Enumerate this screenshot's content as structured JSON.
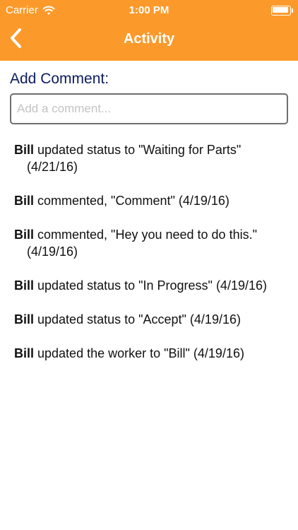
{
  "status_bar": {
    "carrier": "Carrier",
    "time": "1:00 PM",
    "wifi_icon": "wifi-icon",
    "battery_icon": "battery-icon"
  },
  "nav": {
    "back_icon": "chevron-left-icon",
    "title": "Activity",
    "accent_color": "#fb9a2b"
  },
  "comment": {
    "label": "Add Comment:",
    "placeholder": "Add a comment...",
    "label_color": "#0b1c5e"
  },
  "activity": [
    {
      "user": "Bill",
      "text": " updated status to \"Waiting for Parts\" (4/21/16)"
    },
    {
      "user": "Bill",
      "text": " commented, \"Comment\" (4/19/16)"
    },
    {
      "user": "Bill",
      "text": " commented, \"Hey you need to do this.\" (4/19/16)"
    },
    {
      "user": "Bill",
      "text": " updated status to \"In Progress\" (4/19/16)"
    },
    {
      "user": "Bill",
      "text": " updated status to \"Accept\" (4/19/16)"
    },
    {
      "user": "Bill",
      "text": " updated the worker to \"Bill\" (4/19/16)"
    }
  ]
}
